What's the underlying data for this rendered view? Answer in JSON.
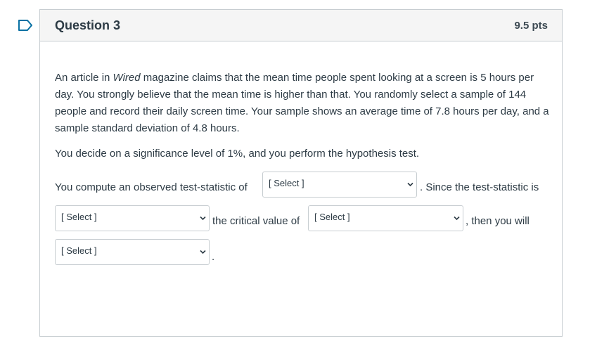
{
  "question": {
    "title": "Question 3",
    "points": "9.5 pts"
  },
  "body": {
    "para1_a": "An article in ",
    "para1_em": "Wired",
    "para1_b": " magazine claims that the mean time people spent looking at a screen is 5 hours per day. You strongly believe that the mean time is higher than that. You randomly select a sample of 144 people and record their daily screen time. Your sample shows an average time of 7.8 hours per day, and a sample standard deviation of 4.8 hours.",
    "para2": "You decide on a significance level of 1%, and you perform the hypothesis test.",
    "line1_pre": "You compute an observed test-statistic of",
    "line1_post": ". Since the test-statistic is",
    "line2_mid": "the critical value of",
    "line2_post": ", then you will",
    "line3_post": "."
  },
  "selects": {
    "test_statistic": "[ Select ]",
    "comparison": "[ Select ]",
    "critical_value": "[ Select ]",
    "decision": "[ Select ]"
  },
  "colors": {
    "flag": "#0770a3",
    "border": "#c7cdd1",
    "header_bg": "#f5f5f5",
    "text": "#2d3b45"
  }
}
